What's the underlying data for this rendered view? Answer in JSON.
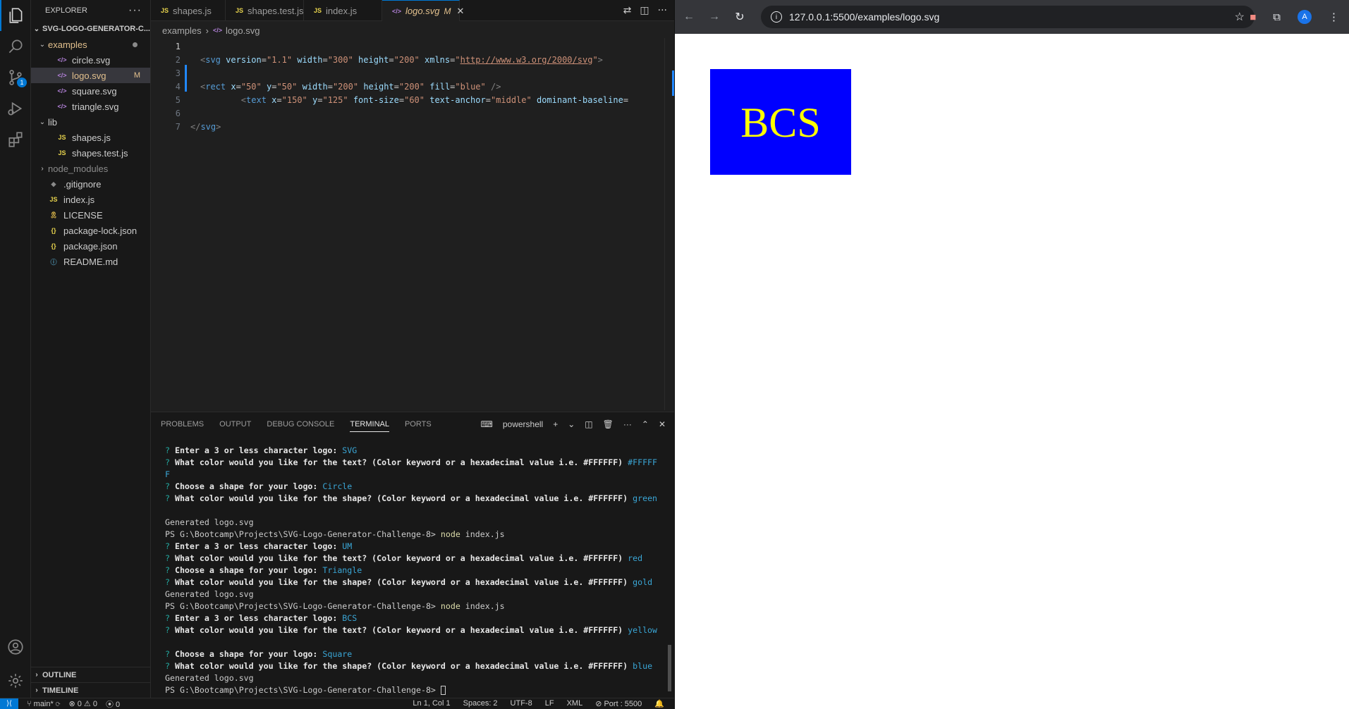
{
  "vscode": {
    "explorer": {
      "header": "EXPLORER",
      "more": "···",
      "root": "SVG-LOGO-GENERATOR-C...",
      "items": [
        {
          "label": "examples",
          "icon": "folder-open-icon",
          "chev": "⌄",
          "indent": 1,
          "type": "folder",
          "dot": true
        },
        {
          "label": "circle.svg",
          "icon": "svg-file-icon",
          "indent": 2,
          "type": "svg"
        },
        {
          "label": "logo.svg",
          "icon": "svg-file-icon",
          "indent": 2,
          "type": "svg",
          "selected": true,
          "suffix": "M"
        },
        {
          "label": "square.svg",
          "icon": "svg-file-icon",
          "indent": 2,
          "type": "svg"
        },
        {
          "label": "triangle.svg",
          "icon": "svg-file-icon",
          "indent": 2,
          "type": "svg"
        },
        {
          "label": "lib",
          "icon": "folder-open-icon",
          "chev": "⌄",
          "indent": 1,
          "type": "folder"
        },
        {
          "label": "shapes.js",
          "icon": "js-file-icon",
          "indent": 2,
          "type": "js"
        },
        {
          "label": "shapes.test.js",
          "icon": "js-file-icon",
          "indent": 2,
          "type": "js"
        },
        {
          "label": "node_modules",
          "icon": "folder-closed-icon",
          "chev": "›",
          "indent": 1,
          "type": "folder",
          "dim": true
        },
        {
          "label": ".gitignore",
          "icon": "gitignore-file-icon",
          "indent": 1,
          "type": "git"
        },
        {
          "label": "index.js",
          "icon": "js-file-icon",
          "indent": 1,
          "type": "js"
        },
        {
          "label": "LICENSE",
          "icon": "license-file-icon",
          "indent": 1,
          "type": "lic"
        },
        {
          "label": "package-lock.json",
          "icon": "json-file-icon",
          "indent": 1,
          "type": "json"
        },
        {
          "label": "package.json",
          "icon": "json-file-icon",
          "indent": 1,
          "type": "json"
        },
        {
          "label": "README.md",
          "icon": "info-file-icon",
          "indent": 1,
          "type": "info"
        }
      ],
      "outline": "OUTLINE",
      "timeline": "TIMELINE"
    },
    "tabs": [
      {
        "label": "shapes.js",
        "type": "js"
      },
      {
        "label": "shapes.test.js",
        "type": "js"
      },
      {
        "label": "index.js",
        "type": "js"
      },
      {
        "label": "logo.svg",
        "type": "svg",
        "active": true,
        "mark": "M",
        "close": "✕"
      }
    ],
    "breadcrumb": {
      "folder": "examples",
      "sep": "›",
      "file": "logo.svg"
    },
    "editor": {
      "lines": [
        {
          "n": "1",
          "tokens": []
        },
        {
          "n": "2",
          "tokens": [
            [
              "tag",
              "<"
            ],
            [
              "name",
              "svg"
            ],
            [
              "txt",
              " "
            ],
            [
              "attr",
              "version"
            ],
            [
              "txt",
              "="
            ],
            [
              "str",
              "\"1.1\""
            ],
            [
              "txt",
              " "
            ],
            [
              "attr",
              "width"
            ],
            [
              "txt",
              "="
            ],
            [
              "str",
              "\"300\""
            ],
            [
              "txt",
              " "
            ],
            [
              "attr",
              "height"
            ],
            [
              "txt",
              "="
            ],
            [
              "str",
              "\"200\""
            ],
            [
              "txt",
              " "
            ],
            [
              "attr",
              "xmlns"
            ],
            [
              "txt",
              "="
            ],
            [
              "str",
              "\""
            ],
            [
              "url",
              "http://www.w3.org/2000/svg"
            ],
            [
              "str",
              "\""
            ],
            [
              "tag",
              ">"
            ]
          ]
        },
        {
          "n": "3",
          "tokens": []
        },
        {
          "n": "4",
          "tokens": [
            [
              "tag",
              "<"
            ],
            [
              "name",
              "rect"
            ],
            [
              "txt",
              " "
            ],
            [
              "attr",
              "x"
            ],
            [
              "txt",
              "="
            ],
            [
              "str",
              "\"50\""
            ],
            [
              "txt",
              " "
            ],
            [
              "attr",
              "y"
            ],
            [
              "txt",
              "="
            ],
            [
              "str",
              "\"50\""
            ],
            [
              "txt",
              " "
            ],
            [
              "attr",
              "width"
            ],
            [
              "txt",
              "="
            ],
            [
              "str",
              "\"200\""
            ],
            [
              "txt",
              " "
            ],
            [
              "attr",
              "height"
            ],
            [
              "txt",
              "="
            ],
            [
              "str",
              "\"200\""
            ],
            [
              "txt",
              " "
            ],
            [
              "attr",
              "fill"
            ],
            [
              "txt",
              "="
            ],
            [
              "str",
              "\"blue\""
            ],
            [
              "txt",
              " "
            ],
            [
              "tag",
              "/>"
            ]
          ]
        },
        {
          "n": "5",
          "tokens": [
            [
              "txt",
              "        "
            ],
            [
              "tag",
              "<"
            ],
            [
              "name",
              "text"
            ],
            [
              "txt",
              " "
            ],
            [
              "attr",
              "x"
            ],
            [
              "txt",
              "="
            ],
            [
              "str",
              "\"150\""
            ],
            [
              "txt",
              " "
            ],
            [
              "attr",
              "y"
            ],
            [
              "txt",
              "="
            ],
            [
              "str",
              "\"125\""
            ],
            [
              "txt",
              " "
            ],
            [
              "attr",
              "font-size"
            ],
            [
              "txt",
              "="
            ],
            [
              "str",
              "\"60\""
            ],
            [
              "txt",
              " "
            ],
            [
              "attr",
              "text-anchor"
            ],
            [
              "txt",
              "="
            ],
            [
              "str",
              "\"middle\""
            ],
            [
              "txt",
              " "
            ],
            [
              "attr",
              "dominant-baseline"
            ],
            [
              "txt",
              "="
            ]
          ]
        },
        {
          "n": "6",
          "tokens": []
        },
        {
          "n": "7",
          "tokens": [
            [
              "tag",
              "</"
            ],
            [
              "name",
              "svg"
            ],
            [
              "tag",
              ">"
            ]
          ]
        }
      ]
    },
    "panel": {
      "tabs": [
        "PROBLEMS",
        "OUTPUT",
        "DEBUG CONSOLE",
        "TERMINAL",
        "PORTS"
      ],
      "active_tab": "TERMINAL",
      "shell": "powershell",
      "terminal_lines": [
        {
          "kind": "q",
          "text": "Enter a 3 or less character logo:",
          "answer": "SVG"
        },
        {
          "kind": "q",
          "text": "What color would you like for the text? (Color keyword or a hexadecimal value i.e. #FFFFFF)",
          "answer": "#FFFFF"
        },
        {
          "kind": "plain",
          "text": "F",
          "answer_style": true
        },
        {
          "kind": "q",
          "text": "Choose a shape for your logo:",
          "answer": "Circle"
        },
        {
          "kind": "q",
          "text": "What color would you like for the shape? (Color keyword or a hexadecimal value i.e. #FFFFFF)",
          "answer": "green"
        },
        {
          "kind": "blank"
        },
        {
          "kind": "plain",
          "text": "Generated logo.svg"
        },
        {
          "kind": "ps",
          "text": "PS G:\\Bootcamp\\Projects\\SVG-Logo-Generator-Challenge-8>",
          "cmd": "node",
          "arg": " index.js"
        },
        {
          "kind": "q",
          "text": "Enter a 3 or less character logo:",
          "answer": "UM"
        },
        {
          "kind": "q",
          "text": "What color would you like for the text? (Color keyword or a hexadecimal value i.e. #FFFFFF)",
          "answer": "red"
        },
        {
          "kind": "q",
          "text": "Choose a shape for your logo:",
          "answer": "Triangle"
        },
        {
          "kind": "q",
          "text": "What color would you like for the shape? (Color keyword or a hexadecimal value i.e. #FFFFFF)",
          "answer": "gold"
        },
        {
          "kind": "plain",
          "text": "Generated logo.svg"
        },
        {
          "kind": "ps",
          "text": "PS G:\\Bootcamp\\Projects\\SVG-Logo-Generator-Challenge-8>",
          "cmd": "node",
          "arg": " index.js"
        },
        {
          "kind": "q",
          "text": "Enter a 3 or less character logo:",
          "answer": "BCS"
        },
        {
          "kind": "q",
          "text": "What color would you like for the text? (Color keyword or a hexadecimal value i.e. #FFFFFF)",
          "answer": "yellow"
        },
        {
          "kind": "blank"
        },
        {
          "kind": "q",
          "text": "Choose a shape for your logo:",
          "answer": "Square"
        },
        {
          "kind": "q",
          "text": "What color would you like for the shape? (Color keyword or a hexadecimal value i.e. #FFFFFF)",
          "answer": "blue"
        },
        {
          "kind": "plain",
          "text": "Generated logo.svg"
        },
        {
          "kind": "prompt",
          "text": "PS G:\\Bootcamp\\Projects\\SVG-Logo-Generator-Challenge-8>"
        }
      ]
    },
    "status": {
      "branch": "main*",
      "errors": "0",
      "warnings": "0",
      "ports": "0",
      "position": "Ln 1, Col 1",
      "spaces": "Spaces: 2",
      "encoding": "UTF-8",
      "eol": "LF",
      "language": "XML",
      "port": "Port : 5500"
    },
    "source_control_badge": "1"
  },
  "browser": {
    "url": "127.0.0.1:5500/examples/logo.svg",
    "avatar_letter": "A",
    "logo": {
      "text": "BCS",
      "fill": "#0000ff",
      "text_color": "#ffff00"
    }
  }
}
